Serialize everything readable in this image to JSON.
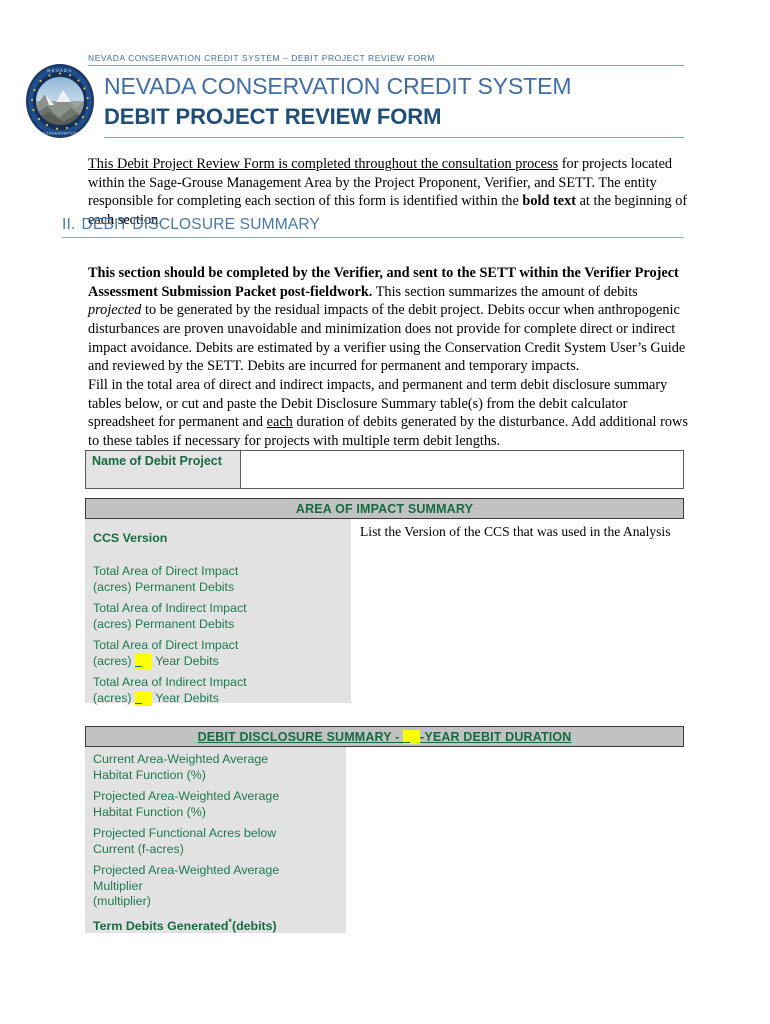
{
  "document": {
    "running_header": "NEVADA CONSERVATION CREDIT SYSTEM – DEBIT PROJECT REVIEW FORM",
    "title_main": "NEVADA CONSERVATION CREDIT SYSTEM",
    "title_sub": "DEBIT PROJECT REVIEW FORM",
    "logo_alt": "nevada-conservation-credit-system-seal"
  },
  "intro": {
    "underlined_lead": "This Debit Project Review Form is completed throughout the consultation process",
    "rest_1": " for projects located within the Sage-Grouse Management Area by the Project Proponent, Verifier, and SETT. The entity responsible for completing each section of this form is identified within the ",
    "bold_phrase": "bold text",
    "rest_2": " at the beginning of each section."
  },
  "section": {
    "number": "II.",
    "title": "DEBIT DISCLOSURE SUMMARY",
    "para1_bold": "This section should be completed by the Verifier, and sent to the SETT within the Verifier Project Assessment Submission Packet post-fieldwork.",
    "para1_a": " This section summarizes the amount of debits ",
    "para1_italic": "projected",
    "para1_b": " to be generated by the residual impacts of the debit project. Debits occur when anthropogenic disturbances are proven unavoidable and minimization does not provide for complete direct or indirect impact avoidance. Debits are estimated by a verifier using the Conservation Credit System User’s Guide and reviewed by the SETT. Debits are incurred for permanent and temporary impacts.",
    "para2_a": "Fill in the total area of direct and indirect impacts, and permanent and term debit disclosure summary tables below, or cut and paste the Debit Disclosure Summary table(s) from the debit calculator spreadsheet for permanent and ",
    "para2_underline": "each",
    "para2_b": " duration of debits generated by the disturbance.  Add additional rows to these tables if necessary for projects with multiple term debit lengths."
  },
  "name_table": {
    "label": "Name of Debit Project",
    "value": ""
  },
  "area_of_impact": {
    "header": "AREA OF IMPACT SUMMARY",
    "note": "List the Version of the CCS that was used in the Analysis",
    "rows": [
      {
        "label": "CCS Version",
        "bold": true,
        "value": ""
      },
      {
        "label_line1": "Total Area of Direct Impact",
        "label_line2": "(acres) Permanent Debits",
        "value": ""
      },
      {
        "label_line1": "Total Area of Indirect Impact",
        "label_line2": "(acres) Permanent Debits",
        "value": ""
      },
      {
        "label_line1": "Total Area of Direct Impact",
        "label_line2_pre": "(acres) ",
        "blank": "",
        "label_line2_post": " Year Debits",
        "value": ""
      },
      {
        "label_line1": "Total Area of Indirect Impact",
        "label_line2_pre": "(acres) ",
        "blank": "",
        "label_line2_post": " Year Debits",
        "value": ""
      }
    ]
  },
  "debit_disclosure": {
    "header_pre": "DEBIT DISCLOSURE SUMMARY - ",
    "header_blank": "",
    "header_post": "-YEAR DEBIT DURATION",
    "rows": [
      {
        "label_line1": "Current Area-Weighted Average",
        "label_line2": "Habitat Function (%)",
        "value": ""
      },
      {
        "label_line1": "Projected Area-Weighted Average",
        "label_line2": "Habitat Function (%)",
        "value": ""
      },
      {
        "label_line1": "Projected Functional Acres below",
        "label_line2": "Current (f-acres)",
        "value": ""
      },
      {
        "label_line1": "Projected Area-Weighted Average",
        "label_line2": "Multiplier",
        "label_line3": "(multiplier)",
        "value": ""
      },
      {
        "label_line1": "Term Debits Generated",
        "superscript": "*",
        "label_line1_cont": "(debits)",
        "bold": true,
        "value": ""
      }
    ]
  },
  "colors": {
    "title_blue": "#3E6DA8",
    "subtitle_navy": "#1F4E79",
    "section_blue": "#4679A8",
    "rule_green": "#7FA8A0",
    "table_green": "#176B41",
    "label_green": "#1E7A50",
    "header_gray": "#C2C2C2",
    "body_gray": "#E2E2E2",
    "highlight_yellow": "#FFFF00"
  }
}
